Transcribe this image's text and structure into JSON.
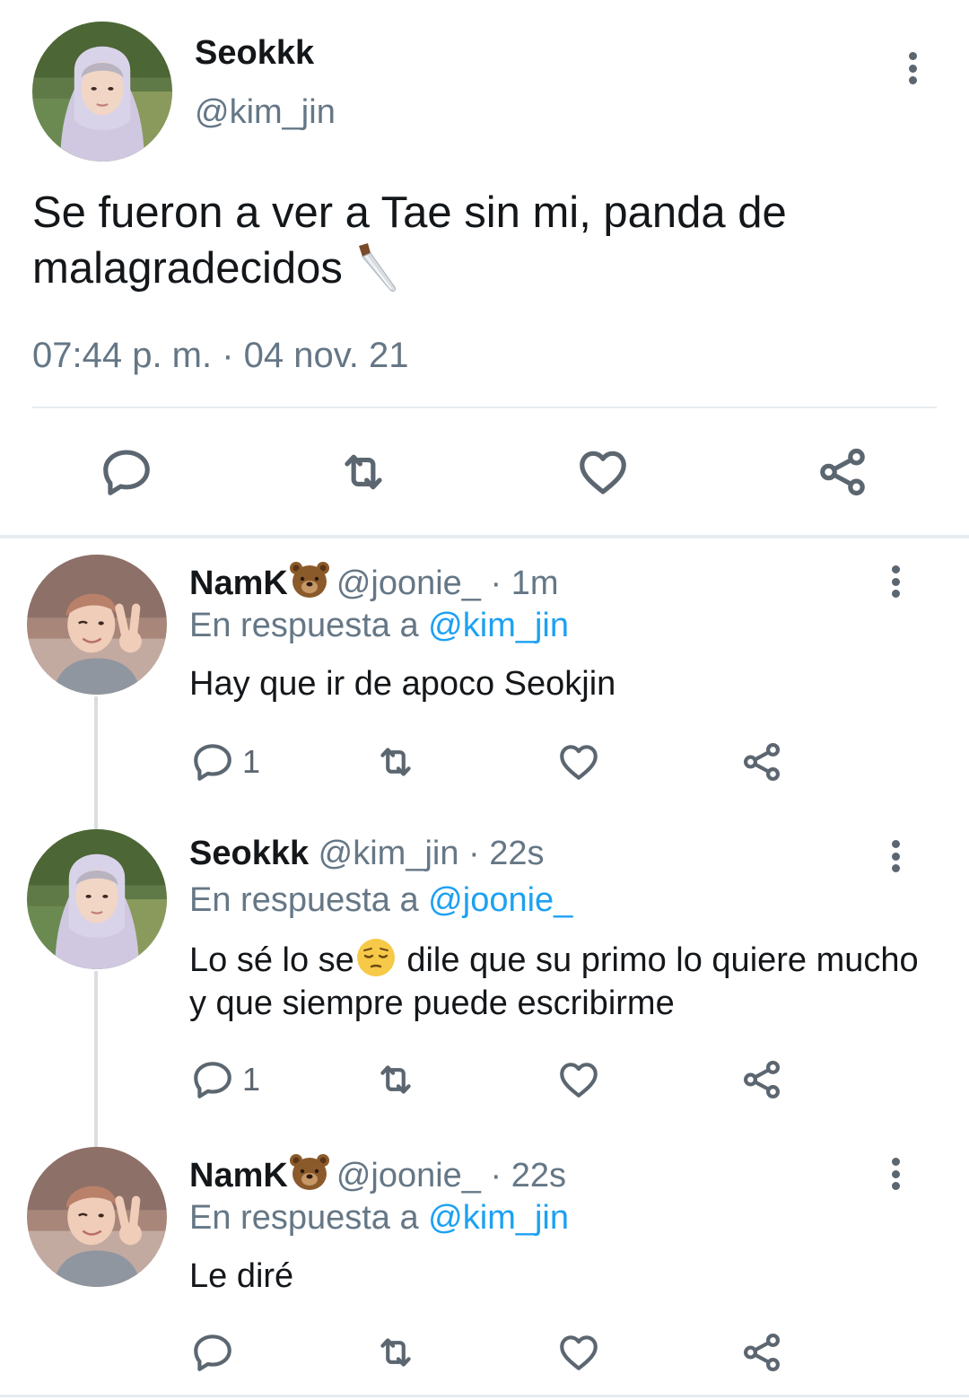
{
  "main_tweet": {
    "name": "Seokkk",
    "handle": "@kim_jin",
    "text": "Se fueron a ver a Tae sin mi, panda de malagradecidos",
    "emoji": "knife-emoji",
    "timestamp": "07:44 p. m. · 04 nov. 21",
    "actions": [
      "reply-icon",
      "retweet-icon",
      "like-icon",
      "share-icon"
    ]
  },
  "replies": [
    {
      "name": "NamK",
      "name_emoji": "bear-emoji",
      "handle": "@joonie_",
      "time": "· 1m",
      "reply_to_prefix": "En respuesta a ",
      "reply_to": "@kim_jin",
      "text": "Hay que ir de apoco Seokjin",
      "reply_count": "1"
    },
    {
      "name": "Seokkk",
      "handle": "@kim_jin",
      "time": "· 22s",
      "reply_to_prefix": "En respuesta a ",
      "reply_to": "@joonie_",
      "text_part1": "Lo sé lo se",
      "text_emoji": "pensive-face-emoji",
      "text_part2": " dile que su primo lo quiere mucho y que siempre puede escribirme",
      "reply_count": "1"
    },
    {
      "name": "NamK",
      "name_emoji": "bear-emoji",
      "handle": "@joonie_",
      "time": "· 22s",
      "reply_to_prefix": "En respuesta a ",
      "reply_to": "@kim_jin",
      "text": "Le diré",
      "reply_count": ""
    }
  ],
  "colors": {
    "text": "#14171a",
    "secondary": "#657786",
    "link": "#1da1f2",
    "icon": "#5b6670",
    "separator": "#e6ecf0"
  }
}
